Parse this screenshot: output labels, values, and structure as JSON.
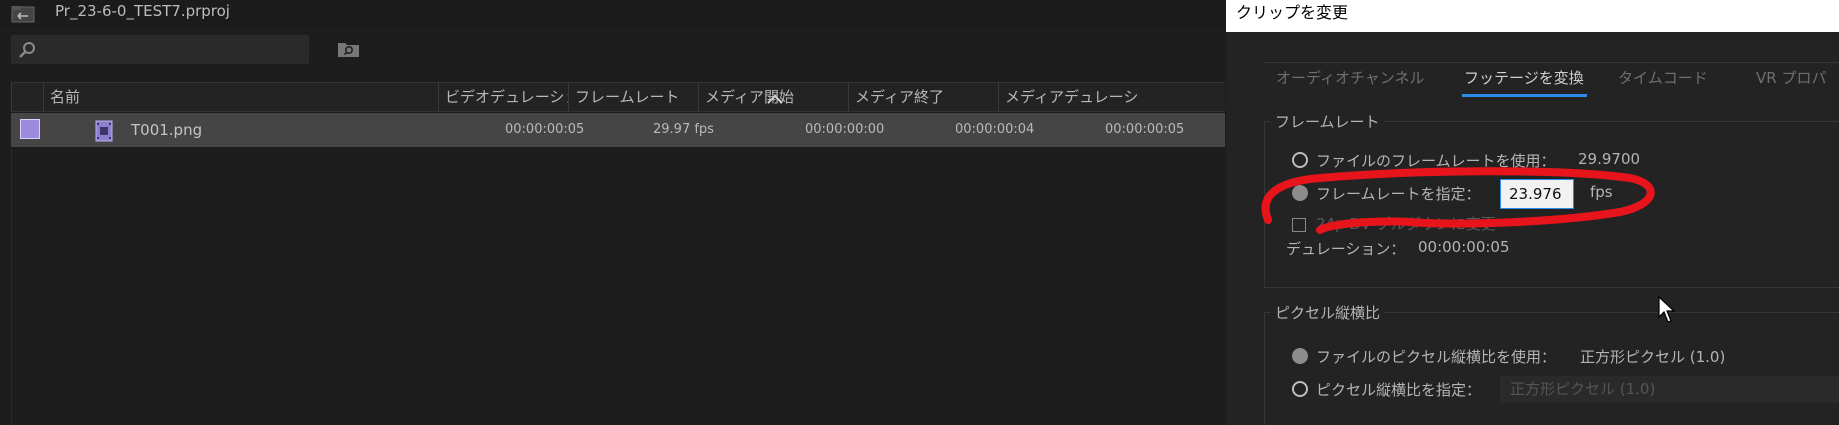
{
  "project": {
    "title": "Pr_23-6-0_TEST7.prproj",
    "search_placeholder": "",
    "columns": [
      "名前",
      "ビデオデュレーショ",
      "フレームレート",
      "メディア開始",
      "メディア終了",
      "メディアデュレーシ"
    ],
    "rows": [
      {
        "name": "T001.png",
        "label_color": "#9b8ade",
        "video_duration": "00:00:00:05",
        "frame_rate": "29.97 fps",
        "media_start": "00:00:00:00",
        "media_end": "00:00:00:04",
        "media_duration": "00:00:00:05"
      }
    ]
  },
  "dialog": {
    "title": "クリップを変更",
    "tabs": [
      "オーディオチャンネル",
      "フッテージを変換",
      "タイムコード",
      "VR プロパ"
    ],
    "active_tab": "フッテージを変換",
    "frame_rate_section": {
      "title": "フレームレート",
      "use_file_label": "ファイルのフレームレートを使用：",
      "file_fps": "29.9700",
      "assume_label": "フレームレートを指定：",
      "assume_value": "23.976",
      "fps_unit": "fps",
      "pulldown_label": "24p DV プルダウンに変更",
      "duration_label": "デュレーション：",
      "duration_value": "00:00:00:05"
    },
    "par_section": {
      "title": "ピクセル縦横比",
      "use_file_label": "ファイルのピクセル縦横比を使用：",
      "file_par": "正方形ピクセル (1.0)",
      "conform_label": "ピクセル縦横比を指定：",
      "conform_value": "正方形ピクセル (1.0)"
    }
  },
  "colors": {
    "accent": "#2d8ceb",
    "annotation": "#e8141c",
    "label_violet": "#9b8ade"
  }
}
